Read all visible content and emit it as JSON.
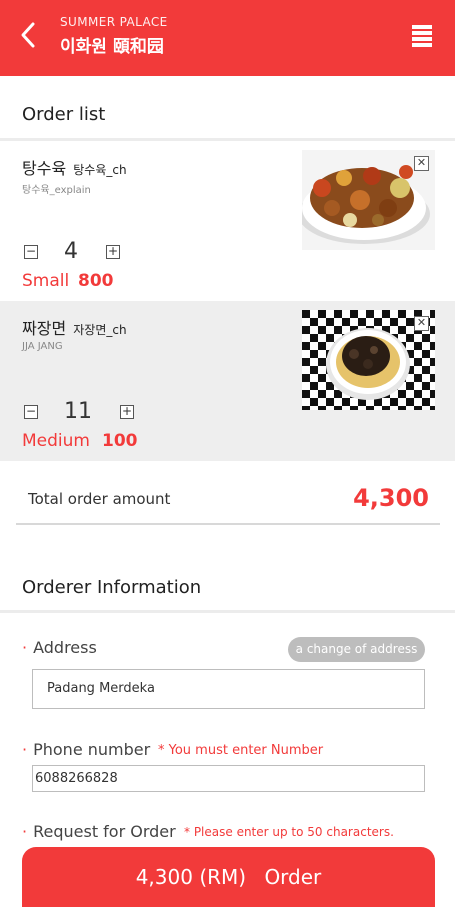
{
  "header": {
    "brand_en": "SUMMER PALACE",
    "brand_ko": "이화원 頤和园",
    "accent_color": "#f23a3a",
    "back_icon": "chevron-left-icon",
    "menu_icon": "hamburger-menu-icon"
  },
  "order_list": {
    "title": "Order list",
    "items": [
      {
        "name": "탕수육",
        "name_sub": "탕수육_ch",
        "desc": "탕수육_explain",
        "quantity": "4",
        "size": "Small",
        "price": "800",
        "image": "sweet-sour-pork-photo"
      },
      {
        "name": "짜장면",
        "name_sub": "자장면_ch",
        "desc": "JJA JANG",
        "quantity": "11",
        "size": "Medium",
        "price": "100",
        "image": "jjajangmyeon-photo"
      }
    ],
    "minus_symbol": "−",
    "plus_symbol": "+",
    "close_symbol": "✕"
  },
  "total": {
    "label": "Total order amount",
    "value": "4,300"
  },
  "orderer": {
    "title": "Orderer Information",
    "bullet": "·",
    "address_label": "Address",
    "change_address_button": "a change of address",
    "address_value": "Padang Merdeka",
    "phone_label": "Phone number",
    "phone_note": "* You must enter Number",
    "phone_value": "6088266828",
    "request_label": "Request for Order",
    "request_note": "* Please enter up to 50 characters."
  },
  "order_button": {
    "amount": "4,300 (RM)",
    "label": "Order"
  }
}
